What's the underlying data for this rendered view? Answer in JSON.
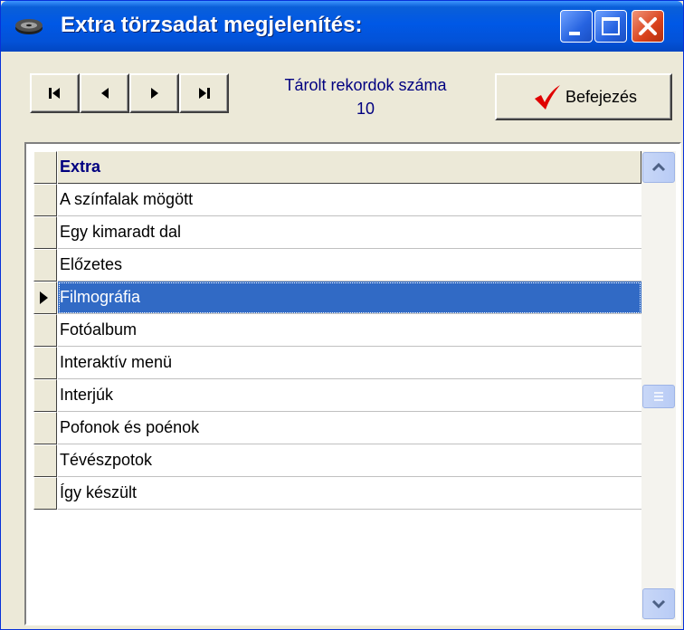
{
  "window": {
    "title": "Extra törzsadat megjelenítés:",
    "title_icon": "disc-icon",
    "controls": [
      "minimize-icon",
      "maximize-icon",
      "close-icon"
    ],
    "accent_color": "#0058e6"
  },
  "toolbar": {
    "nav_buttons": [
      "first-record-icon",
      "previous-record-icon",
      "next-record-icon",
      "last-record-icon"
    ],
    "records_label": "Tárolt rekordok száma",
    "records_count": "10",
    "finish_label": "Befejezés",
    "finish_icon": "checkmark-icon",
    "finish_icon_color": "#e00000"
  },
  "grid": {
    "column_header": "Extra",
    "rows": [
      "A színfalak mögött",
      "Egy kimaradt dal",
      "Előzetes",
      "Filmográfia",
      "Fotóalbum",
      "Interaktív menü",
      "Interjúk",
      "Pofonok és poénok",
      "Tévészpotok",
      "Így készült"
    ],
    "selected_row": "Filmográfia",
    "selection_color": "#316ac5"
  }
}
